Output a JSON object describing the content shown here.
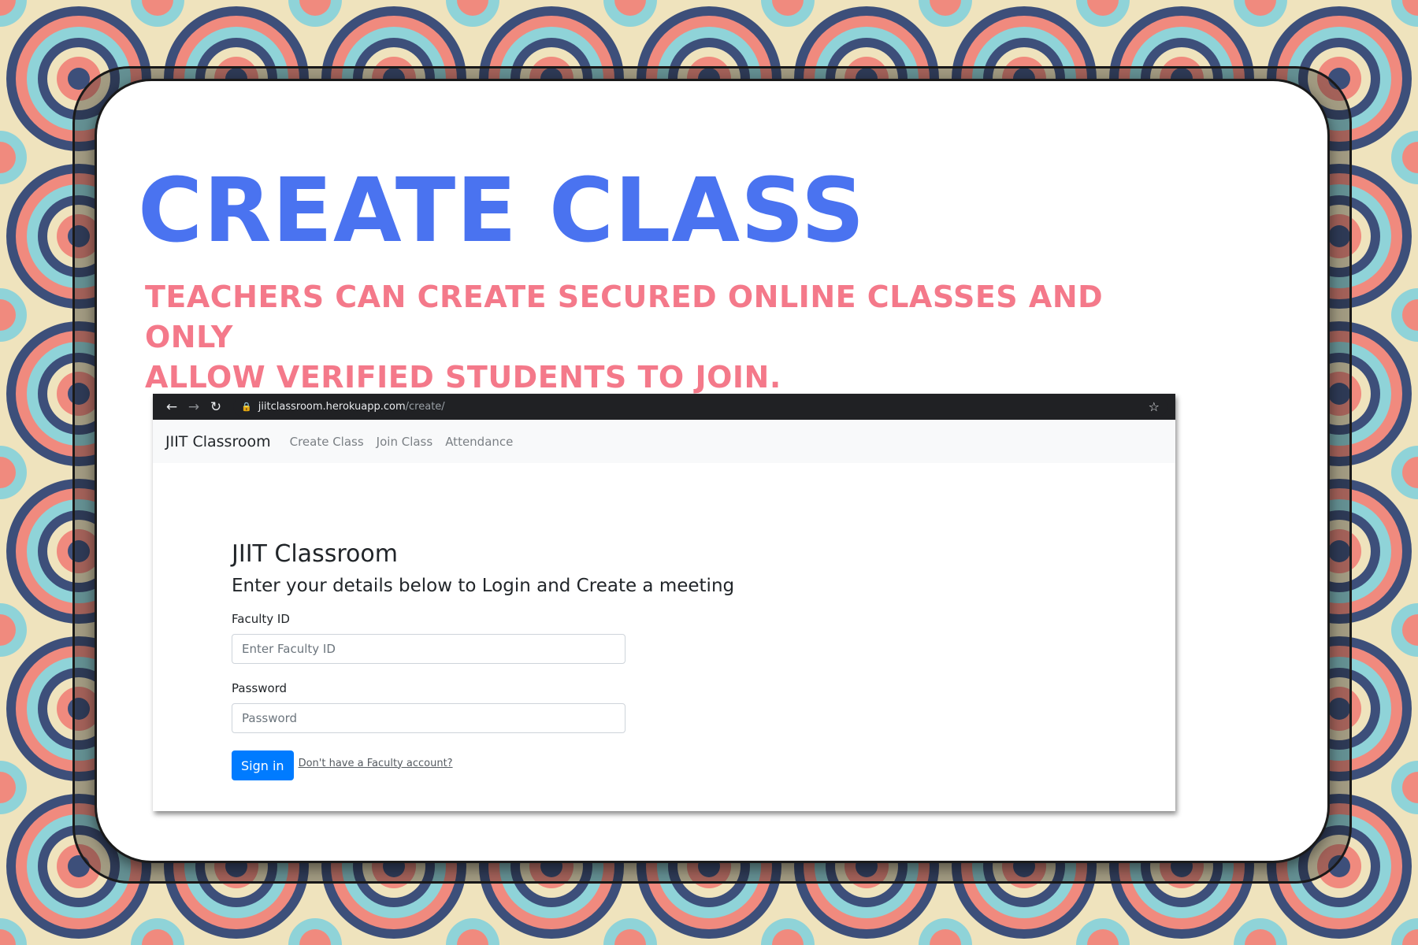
{
  "hero": {
    "title": "CREATE CLASS",
    "subtitle_line1": "TEACHERS CAN CREATE SECURED ONLINE CLASSES AND ONLY",
    "subtitle_line2": "ALLOW VERIFIED STUDENTS TO JOIN."
  },
  "colors": {
    "title": "#4a73f0",
    "subtitle": "#f4798a",
    "primary_button": "#007bff"
  },
  "browser": {
    "back_icon": "arrow-left-icon",
    "forward_icon": "arrow-right-icon",
    "reload_icon": "reload-icon",
    "lock_icon": "lock-icon",
    "bookmark_icon": "star-icon",
    "url_host": "jiitclassroom.herokuapp.com",
    "url_path": "/create/"
  },
  "navbar": {
    "brand": "JIIT Classroom",
    "links": [
      "Create Class",
      "Join Class",
      "Attendance"
    ]
  },
  "form": {
    "title": "JIIT Classroom",
    "subtitle": "Enter your details below to Login and Create a meeting",
    "faculty_label": "Faculty ID",
    "faculty_placeholder": "Enter Faculty ID",
    "password_label": "Password",
    "password_placeholder": "Password",
    "submit_label": "Sign in",
    "signup_link": "Don't have a Faculty account?"
  }
}
